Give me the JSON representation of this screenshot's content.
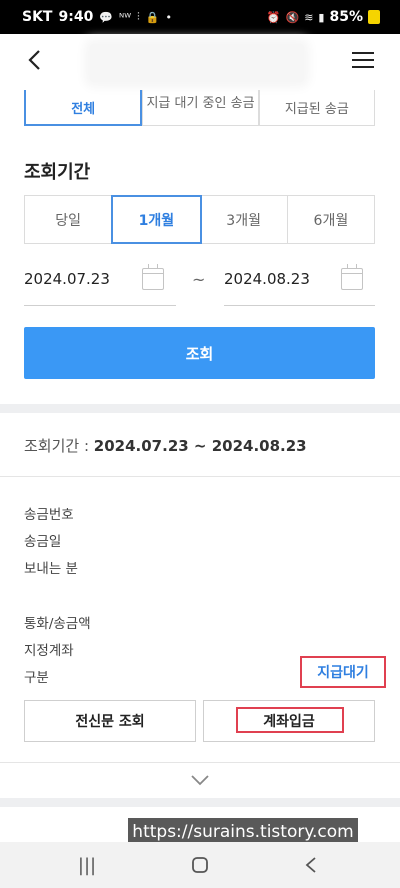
{
  "status_bar": {
    "carrier": "SKT",
    "time": "9:40",
    "icons_left": [
      "message-icon",
      "mvno-icon",
      "signal-icon",
      "lock-icon",
      "dot-icon"
    ],
    "battery": "85%"
  },
  "header": {
    "back_icon": "chevron-left-icon",
    "menu_icon": "hamburger-icon"
  },
  "tabs": [
    {
      "label": "전체",
      "active": true
    },
    {
      "label": "지급 대기 중인 송금",
      "active": false
    },
    {
      "label": "지급된 송금",
      "active": false
    }
  ],
  "period_title": "조회기간",
  "period_options": [
    {
      "label": "당일",
      "active": false
    },
    {
      "label": "1개월",
      "active": true
    },
    {
      "label": "3개월",
      "active": false
    },
    {
      "label": "6개월",
      "active": false
    }
  ],
  "date_from": "2024.07.23",
  "date_to": "2024.08.23",
  "tilde": "~",
  "search_button": "조회",
  "result": {
    "period_label": "조회기간 : ",
    "period_dates": "2024.07.23 ~ 2024.08.23",
    "fields": {
      "remit_no": "송금번호",
      "remit_date": "송금일",
      "sender": "보내는 분",
      "currency_amount": "통화/송금액",
      "account": "지정계좌",
      "type": "구분"
    },
    "status": "지급대기",
    "btn_telegram": "전신문 조회",
    "btn_deposit": "계좌입금"
  },
  "watermark": "https://surains.tistory.com",
  "colors": {
    "accent": "#3a98f5",
    "highlight": "#e04050",
    "active_text": "#2f7fe0"
  }
}
